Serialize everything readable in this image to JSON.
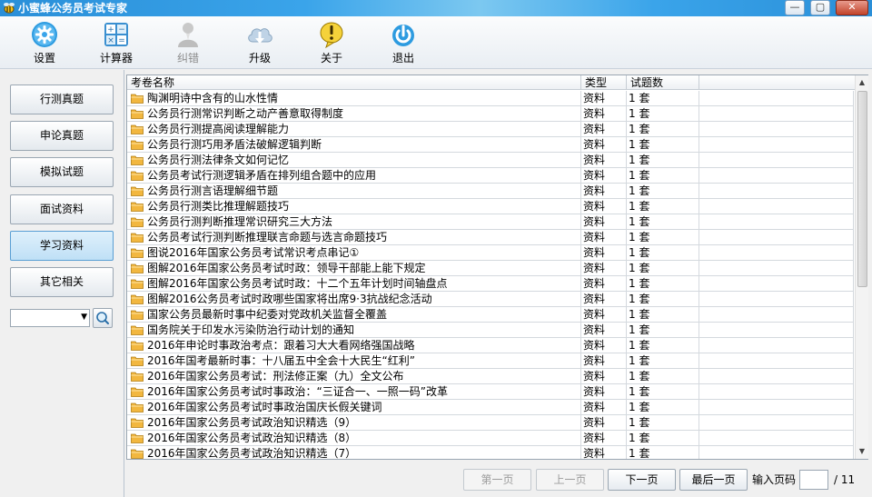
{
  "window": {
    "title": "小蜜蜂公务员考试专家",
    "controls": {
      "minimize": "—",
      "maximize": "▢",
      "close": "✕"
    }
  },
  "toolbar": {
    "items": [
      {
        "label": "设置",
        "icon": "gear-icon",
        "enabled": true
      },
      {
        "label": "计算器",
        "icon": "calculator-icon",
        "enabled": true
      },
      {
        "label": "纠错",
        "icon": "person-icon",
        "enabled": false
      },
      {
        "label": "升级",
        "icon": "cloud-download-icon",
        "enabled": true
      },
      {
        "label": "关于",
        "icon": "exclamation-icon",
        "enabled": true
      },
      {
        "label": "退出",
        "icon": "power-icon",
        "enabled": true
      }
    ]
  },
  "sidebar": {
    "items": [
      {
        "label": "行测真题",
        "active": false
      },
      {
        "label": "申论真题",
        "active": false
      },
      {
        "label": "模拟试题",
        "active": false
      },
      {
        "label": "面试资料",
        "active": false
      },
      {
        "label": "学习资料",
        "active": true
      },
      {
        "label": "其它相关",
        "active": false
      }
    ],
    "search_value": ""
  },
  "table": {
    "columns": [
      "考卷名称",
      "类型",
      "试题数"
    ],
    "rows": [
      [
        "陶渊明诗中含有的山水性情",
        "资料",
        "1 套"
      ],
      [
        "公务员行测常识判断之动产善意取得制度",
        "资料",
        "1 套"
      ],
      [
        "公务员行测提高阅读理解能力",
        "资料",
        "1 套"
      ],
      [
        "公务员行测巧用矛盾法破解逻辑判断",
        "资料",
        "1 套"
      ],
      [
        "公务员行测法律条文如何记忆",
        "资料",
        "1 套"
      ],
      [
        "公务员考试行测逻辑矛盾在排列组合题中的应用",
        "资料",
        "1 套"
      ],
      [
        "公务员行测言语理解细节题",
        "资料",
        "1 套"
      ],
      [
        "公务员行测类比推理解题技巧",
        "资料",
        "1 套"
      ],
      [
        "公务员行测判断推理常识研究三大方法",
        "资料",
        "1 套"
      ],
      [
        "公务员考试行测判断推理联言命题与选言命题技巧",
        "资料",
        "1 套"
      ],
      [
        "图说2016年国家公务员考试常识考点串记①",
        "资料",
        "1 套"
      ],
      [
        "图解2016年国家公务员考试时政：领导干部能上能下规定",
        "资料",
        "1 套"
      ],
      [
        "图解2016年国家公务员考试时政：十二个五年计划时间轴盘点",
        "资料",
        "1 套"
      ],
      [
        "图解2016公务员考试时政哪些国家将出席9·3抗战纪念活动",
        "资料",
        "1 套"
      ],
      [
        "国家公务员最新时事中纪委对党政机关监督全覆盖",
        "资料",
        "1 套"
      ],
      [
        "国务院关于印发水污染防治行动计划的通知",
        "资料",
        "1 套"
      ],
      [
        "2016年申论时事政治考点：跟着习大大看网络强国战略",
        "资料",
        "1 套"
      ],
      [
        "2016年国考最新时事：十八届五中全会十大民生“红利”",
        "资料",
        "1 套"
      ],
      [
        "2016年国家公务员考试：刑法修正案（九）全文公布",
        "资料",
        "1 套"
      ],
      [
        "2016年国家公务员考试时事政治：“三证合一、一照一码”改革",
        "资料",
        "1 套"
      ],
      [
        "2016年国家公务员考试时事政治国庆长假关键词",
        "资料",
        "1 套"
      ],
      [
        "2016年国家公务员考试政治知识精选（9）",
        "资料",
        "1 套"
      ],
      [
        "2016年国家公务员考试政治知识精选（8）",
        "资料",
        "1 套"
      ],
      [
        "2016年国家公务员考试政治知识精选（7）",
        "资料",
        "1 套"
      ]
    ]
  },
  "pager": {
    "first": "第一页",
    "prev": "上一页",
    "next": "下一页",
    "last": "最后一页",
    "input_label": "输入页码",
    "input_value": "",
    "total": "/ 11"
  },
  "colors": {
    "accent": "#3aa4ea",
    "folder": "#f2b73f"
  }
}
